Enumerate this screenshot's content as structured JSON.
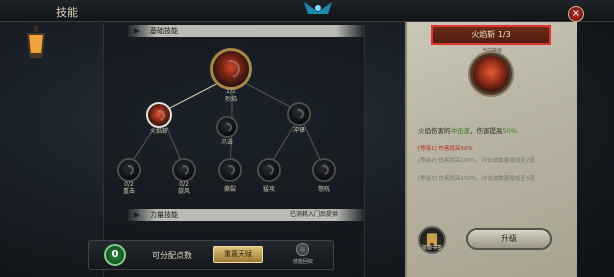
{
  "window": {
    "title": "技能",
    "close_icon": "close-icon"
  },
  "tree": {
    "section_basic": "基础技能",
    "section_power": "力量技能",
    "section_power_hint": "已消耗入门后提供",
    "nodes": [
      {
        "id": "root",
        "level": "1/1",
        "name": "烈焰",
        "icon": "fire-demon-icon",
        "state": "learned"
      },
      {
        "id": "fireball",
        "name": "火焰斩",
        "icon": "fire-slash-icon",
        "state": "selected"
      },
      {
        "id": "claw",
        "name": "爪击",
        "icon": "claw-icon",
        "state": "locked"
      },
      {
        "id": "dash",
        "name": "冲锋",
        "icon": "dash-icon",
        "state": "locked"
      },
      {
        "id": "n1",
        "level": "0/2",
        "name": "重击",
        "icon": "smash-icon",
        "state": "locked"
      },
      {
        "id": "n2",
        "level": "0/2",
        "name": "旋风",
        "icon": "whirl-icon",
        "state": "locked"
      },
      {
        "id": "n3",
        "name": "撕裂",
        "icon": "rend-icon",
        "state": "locked"
      },
      {
        "id": "n4",
        "name": "猛攻",
        "icon": "assault-icon",
        "state": "locked"
      },
      {
        "id": "n5",
        "name": "怒吼",
        "icon": "roar-icon",
        "state": "locked"
      }
    ]
  },
  "bottom": {
    "available_points": "0",
    "points_label": "可分配点数",
    "reset_label": "重置天赋",
    "orb_label": "技能回收"
  },
  "detail": {
    "title": "火焰斩 1/3",
    "icon_caption": "当前等级",
    "description_a": "火焰伤害的",
    "description_hl": "冲击波",
    "description_b": "，伤害提高",
    "description_pct": "50%",
    "level1": "[等级1] 伤害提高50%",
    "level2": "[等级2] 伤害提高100%，冲击波数量增加至2道",
    "level3": "[等级3] 伤害提高150%，冲击波数量增加至3道",
    "upgrade_label": "升级",
    "bookmark_label": "技能书签"
  },
  "colors": {
    "accent_red": "#e3312f",
    "parchment": "#bdb8a8",
    "gold": "#d8bb6c",
    "green": "#3a7b1f"
  }
}
